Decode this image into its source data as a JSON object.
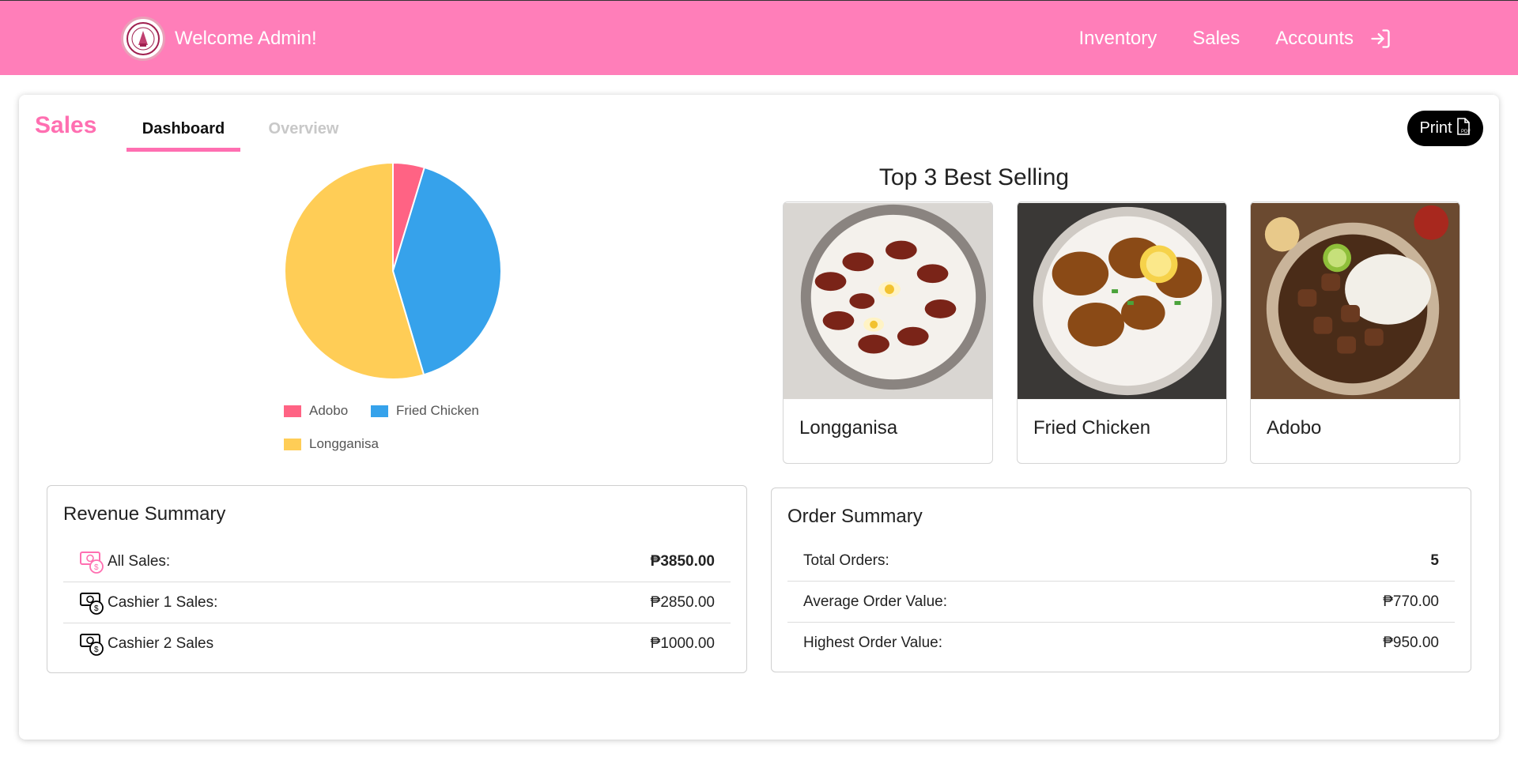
{
  "navbar": {
    "welcome": "Welcome Admin!",
    "links": [
      "Inventory",
      "Sales",
      "Accounts"
    ],
    "bg_color": "#ff7eb9"
  },
  "page": {
    "title": "Sales",
    "tabs": [
      "Dashboard",
      "Overview"
    ],
    "active_tab": "Dashboard",
    "print_label": "Print"
  },
  "chart_data": {
    "type": "pie",
    "labels": [
      "Adobo",
      "Fried Chicken",
      "Longganisa"
    ],
    "values": [
      4.7,
      40.7,
      54.6
    ],
    "colors": [
      "#ff6384",
      "#36a2eb",
      "#ffcd56"
    ],
    "legend_position": "bottom"
  },
  "best_selling": {
    "title": "Top 3 Best Selling",
    "items": [
      "Longganisa",
      "Fried Chicken",
      "Adobo"
    ]
  },
  "revenue": {
    "title": "Revenue Summary",
    "rows": [
      {
        "label": "All Sales:",
        "value": "₱3850.00"
      },
      {
        "label": "Cashier 1 Sales:",
        "value": "₱2850.00"
      },
      {
        "label": "Cashier 2 Sales",
        "value": "₱1000.00"
      }
    ]
  },
  "orders": {
    "title": "Order Summary",
    "rows": [
      {
        "label": "Total Orders:",
        "value": "5"
      },
      {
        "label": "Average Order Value:",
        "value": "₱770.00"
      },
      {
        "label": "Highest Order Value:",
        "value": "₱950.00"
      }
    ]
  }
}
